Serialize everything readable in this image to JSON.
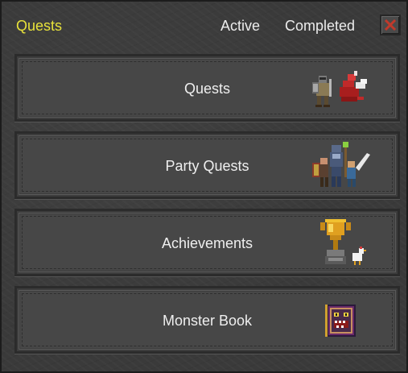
{
  "window": {
    "title": "Quests",
    "tabs": [
      {
        "label": "Active"
      },
      {
        "label": "Completed"
      }
    ],
    "close_icon": "close-icon"
  },
  "menu": [
    {
      "label": "Quests",
      "icon": "knight-and-dragon-icon"
    },
    {
      "label": "Party Quests",
      "icon": "adventurer-party-icon"
    },
    {
      "label": "Achievements",
      "icon": "trophy-icon"
    },
    {
      "label": "Monster Book",
      "icon": "monster-book-icon"
    }
  ],
  "colors": {
    "title": "#e8e23a",
    "tab_text": "#ececec",
    "close_x": "#c0392b",
    "panel": "#3a3a3a",
    "button": "#474747"
  }
}
